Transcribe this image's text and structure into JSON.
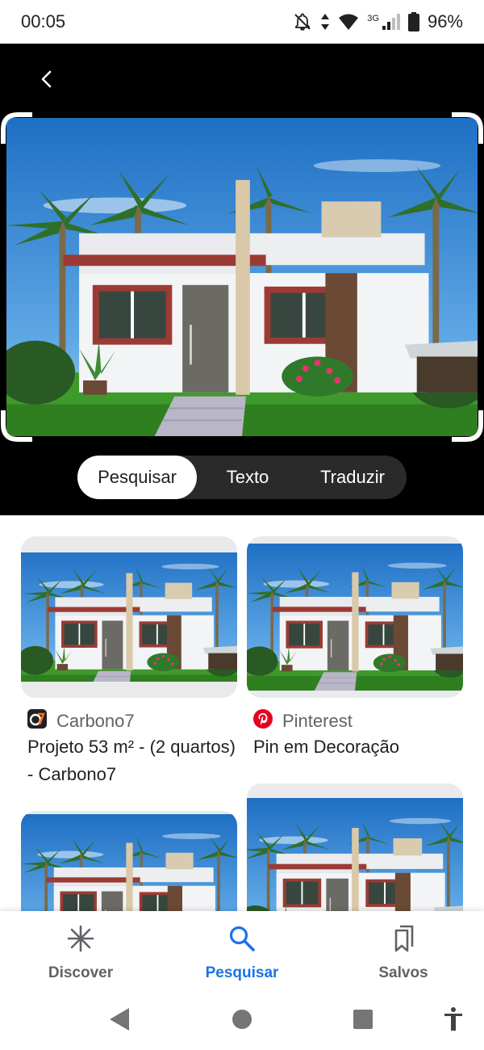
{
  "status_bar": {
    "time": "00:05",
    "network": "3G",
    "battery": "96%",
    "icons": [
      "notifications-off-icon",
      "data-arrows-icon",
      "wifi-icon",
      "signal-icon",
      "battery-icon"
    ]
  },
  "lens": {
    "back_icon": "chevron-left-icon",
    "modes": [
      "Pesquisar",
      "Texto",
      "Traduzir"
    ],
    "active_mode": "Pesquisar"
  },
  "results": [
    {
      "source": "Carbono7",
      "source_icon": "carbono7-logo-icon",
      "title": "Projeto 53 m² - (2 quartos) - Carbono7"
    },
    {
      "source": "Pinterest",
      "source_icon": "pinterest-logo-icon",
      "title": "Pin em Decoração"
    }
  ],
  "bottom_nav": {
    "items": [
      {
        "label": "Discover",
        "icon": "asterisk-icon"
      },
      {
        "label": "Pesquisar",
        "icon": "search-icon"
      },
      {
        "label": "Salvos",
        "icon": "bookmarks-icon"
      }
    ],
    "active": "Pesquisar"
  },
  "system_nav": {
    "icons": [
      "back-triangle-icon",
      "home-circle-icon",
      "recents-square-icon",
      "accessibility-icon"
    ]
  },
  "colors": {
    "accent": "#1a73e8",
    "pinterest": "#e60023",
    "carbono7": "#ff6a13"
  }
}
